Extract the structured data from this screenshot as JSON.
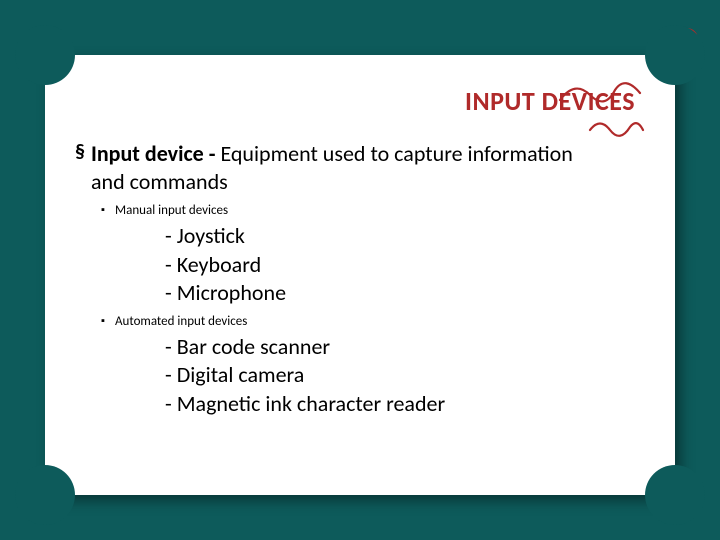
{
  "title": "INPUT DEVICES",
  "definition": {
    "term": "Input device - ",
    "text": "Equipment used to capture information and commands"
  },
  "sections": [
    {
      "heading": "Manual input devices",
      "items": [
        "Joystick",
        "Keyboard",
        "Microphone"
      ]
    },
    {
      "heading": "Automated input devices",
      "items": [
        "Bar code scanner",
        "Digital camera",
        "Magnetic ink character reader"
      ]
    }
  ],
  "colors": {
    "background": "#0d5b5b",
    "accent": "#b02a2a",
    "card": "#ffffff"
  }
}
